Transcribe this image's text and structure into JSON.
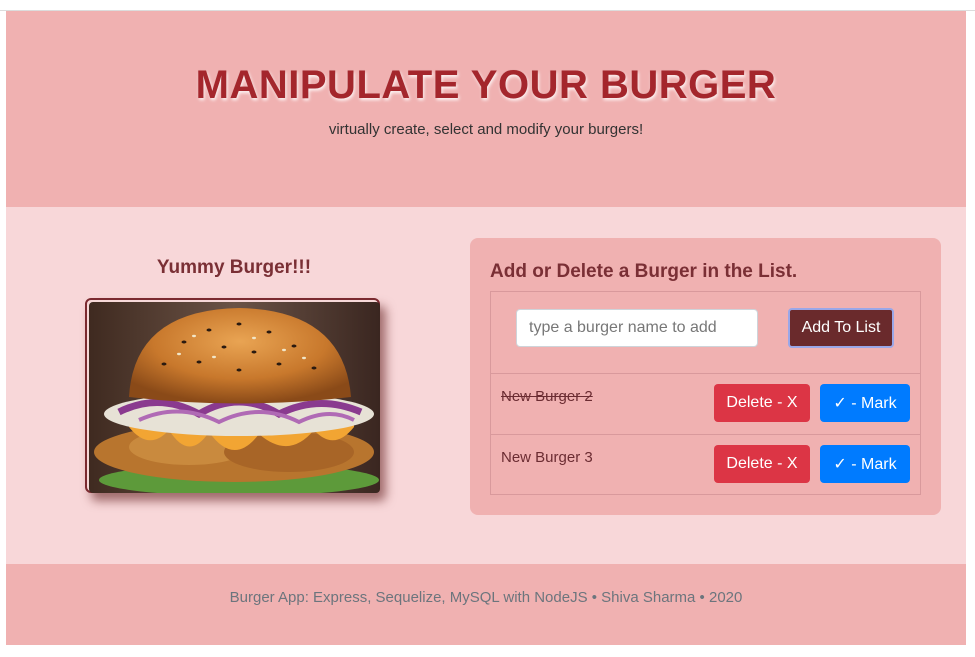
{
  "header": {
    "title": "MANIPULATE YOUR BURGER",
    "subtitle": "virtually create, select and modify your burgers!"
  },
  "left_panel": {
    "title": "Yummy Burger!!!"
  },
  "card": {
    "title": "Add or Delete a Burger in the List.",
    "input": {
      "value": "",
      "placeholder": "type a burger name to add"
    },
    "add_button_label": "Add To List",
    "burgers": [
      {
        "name": "New Burger 2",
        "devoured": true,
        "delete_label": "Delete - X",
        "mark_label": "✓ - Mark"
      },
      {
        "name": "New Burger 3",
        "devoured": false,
        "delete_label": "Delete - X",
        "mark_label": "✓ - Mark"
      }
    ]
  },
  "footer": {
    "text": "Burger App: Express, Sequelize, MySQL with NodeJS • Shiva Sharma • 2020"
  },
  "colors": {
    "header_bg": "#f0b1b1",
    "main_bg": "#f8d7d9",
    "title_red": "#a4262c",
    "add_button": "#6a2a2c",
    "delete_button": "#dc3545",
    "mark_button": "#007bff"
  }
}
